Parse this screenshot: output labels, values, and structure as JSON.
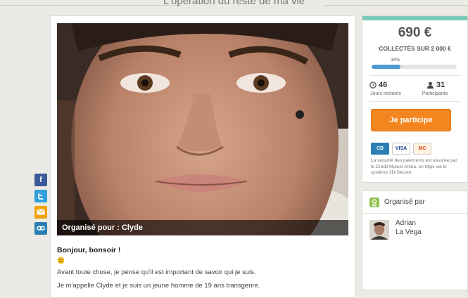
{
  "header": {
    "title": "L'opération du reste de ma vie"
  },
  "campaign": {
    "caption": "Organisé pour : Clyde",
    "greeting": "Bonjour, bonsoir !",
    "paragraphs": [
      "Avant toute chose, je pense qu'il est important de savoir qui je suis.",
      "Je m'appelle Clyde et je suis un jeune homme de 19 ans transgenre."
    ]
  },
  "share": {
    "icons": [
      "facebook-icon",
      "twitter-icon",
      "email-icon",
      "link-icon"
    ]
  },
  "funding": {
    "amount": "690 €",
    "collected_label": "COLLECTÉS SUR 2 000 €",
    "percent_label": "34%",
    "progress": 0.34,
    "days_value": "46",
    "days_label": "Jours restants",
    "participants_value": "31",
    "participants_label": "Participants",
    "cta_label": "Je participe",
    "cards": [
      "CB",
      "VISA",
      "MC"
    ],
    "security_text": "La sécurité des paiements est assurée par le Crédit Mutuel Arkéa, en https via le système 3D-Secure."
  },
  "organizer": {
    "label": "Organisé par",
    "first_name": "Adrian",
    "last_name": "La Vega"
  },
  "colors": {
    "accent": "#f4861f",
    "progress": "#4d9ad2",
    "green": "#8cc04b"
  }
}
